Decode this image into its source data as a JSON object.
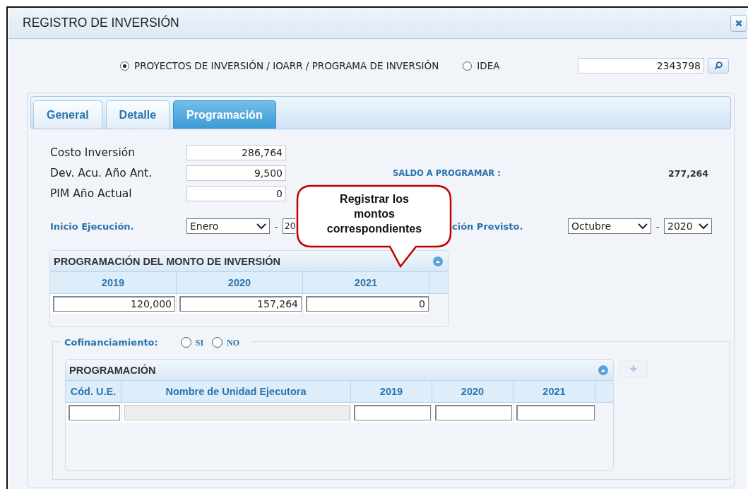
{
  "dialog": {
    "title": "REGISTRO DE INVERSIÓN"
  },
  "search_type": [
    {
      "label": "PROYECTOS DE INVERSIÓN / IOARR / PROGRAMA DE INVERSIÓN",
      "selected": true
    },
    {
      "label": "IDEA",
      "selected": false
    }
  ],
  "search": {
    "value": "2343798"
  },
  "tabs": [
    {
      "label": "General",
      "selected": false
    },
    {
      "label": "Detalle",
      "selected": false
    },
    {
      "label": "Programación",
      "selected": true
    }
  ],
  "amounts": [
    {
      "label": "Costo Inversión",
      "value": "286,764"
    },
    {
      "label": "Dev. Acu. Año Ant.",
      "value": "9,500"
    },
    {
      "label": "PIM Año Actual",
      "value": "0"
    }
  ],
  "balance": {
    "label": "SALDO A PROGRAMAR :",
    "value": "277,264"
  },
  "start": {
    "label": "Inicio Ejecución.",
    "month": "Enero",
    "separator": "-",
    "year": "20"
  },
  "end": {
    "label": "ción Previsto.",
    "month": "Octubre",
    "separator": "-",
    "year": "2020"
  },
  "investment_panel": {
    "title": "PROGRAMACIÓN DEL MONTO DE INVERSIÓN",
    "columns": [
      "2019",
      "2020",
      "2021"
    ],
    "values": [
      "120,000",
      "157,264",
      "0"
    ]
  },
  "cofinancing": {
    "label": "Cofinanciamiento:",
    "options": [
      {
        "label": "SI",
        "selected": false
      },
      {
        "label": "NO",
        "selected": false
      }
    ]
  },
  "programming_panel": {
    "title": "PROGRAMACIÓN",
    "add_disabled": true,
    "columns": [
      {
        "label": "Cód. U.E.",
        "disabled": false
      },
      {
        "label": "Nombre de Unidad Ejecutora",
        "disabled": true
      },
      {
        "label": "2019",
        "disabled": false
      },
      {
        "label": "2020",
        "disabled": false
      },
      {
        "label": "2021",
        "disabled": false
      }
    ]
  },
  "callout": {
    "text": "Registrar los montos correspondientes"
  }
}
